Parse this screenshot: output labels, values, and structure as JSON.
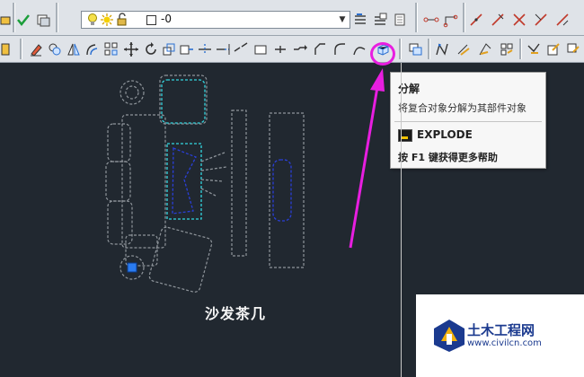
{
  "layer_combo": {
    "value": "-0"
  },
  "tooltip": {
    "title": "分解",
    "description": "将复合对象分解为其部件对象",
    "command": "EXPLODE",
    "help": "按 F1 键获得更多帮助"
  },
  "drawing": {
    "label": "沙发茶几"
  },
  "watermark": {
    "name": "土木工程网",
    "url": "www.civilcn.com"
  },
  "colors": {
    "highlight": "#e81ee0",
    "canvas": "#212830",
    "toolbar": "#dfe3e8"
  },
  "icons": {
    "row1": [
      "layer-match-icon",
      "layer-properties-icon",
      "layer-bulb-icon",
      "layer-sun-icon",
      "layer-lock-icon",
      "layer-prev-icon",
      "layer-state-icon",
      "layer-iso-icon",
      "dimension-linear-icon",
      "dimension-aligned-icon",
      "dimension-angular-icon",
      "dimension-arc-icon",
      "dimension-x-icon"
    ],
    "row2": [
      "erase-icon",
      "copy-icon",
      "mirror-icon",
      "offset-icon",
      "array-icon",
      "move-icon",
      "rotate-icon",
      "scale-icon",
      "stretch-icon",
      "trim-icon",
      "extend-icon",
      "break-point-icon",
      "break-icon",
      "join-icon",
      "chamfer-icon",
      "fillet-icon",
      "blend-icon",
      "explode-icon",
      "draw-order-icon",
      "edit-polyline-icon",
      "edit-spline-icon",
      "edit-hatch-icon",
      "edit-text-icon",
      "edit-attribute-icon",
      "match-properties-icon"
    ]
  }
}
